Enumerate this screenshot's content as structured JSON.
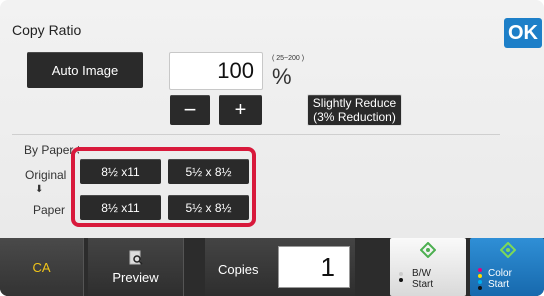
{
  "header": {
    "title": "Copy Ratio",
    "ok_label": "OK"
  },
  "ratio": {
    "auto_image_label": "Auto Image",
    "value": "100",
    "range": "( 25~200 )",
    "unit": "%",
    "minus_label": "−",
    "plus_label": "+",
    "preset_line1": "Slightly Reduce",
    "preset_line2": "(3% Reduction)"
  },
  "paper_size": {
    "section_label": "By Paper Size",
    "original_label": "Original",
    "arrow": "⬇",
    "paper_label": "Paper",
    "original_sizes": [
      "8½ x11",
      "5½ x 8½"
    ],
    "paper_sizes": [
      "8½ x11",
      "5½ x 8½"
    ]
  },
  "footer": {
    "ca_label": "CA",
    "preview_label": "Preview",
    "copies_label": "Copies",
    "copies_value": "1",
    "bw_start_line1": "B/W",
    "bw_start_line2": "Start",
    "color_start_line1": "Color",
    "color_start_line2": "Start"
  },
  "colors": {
    "accent": "#1d7fc8",
    "highlight": "#d8193b",
    "ca_text": "#f0c419",
    "start_icon": "#4caf50"
  },
  "icons": {
    "preview": "magnifier-page-icon",
    "start": "diamond-start-icon"
  }
}
